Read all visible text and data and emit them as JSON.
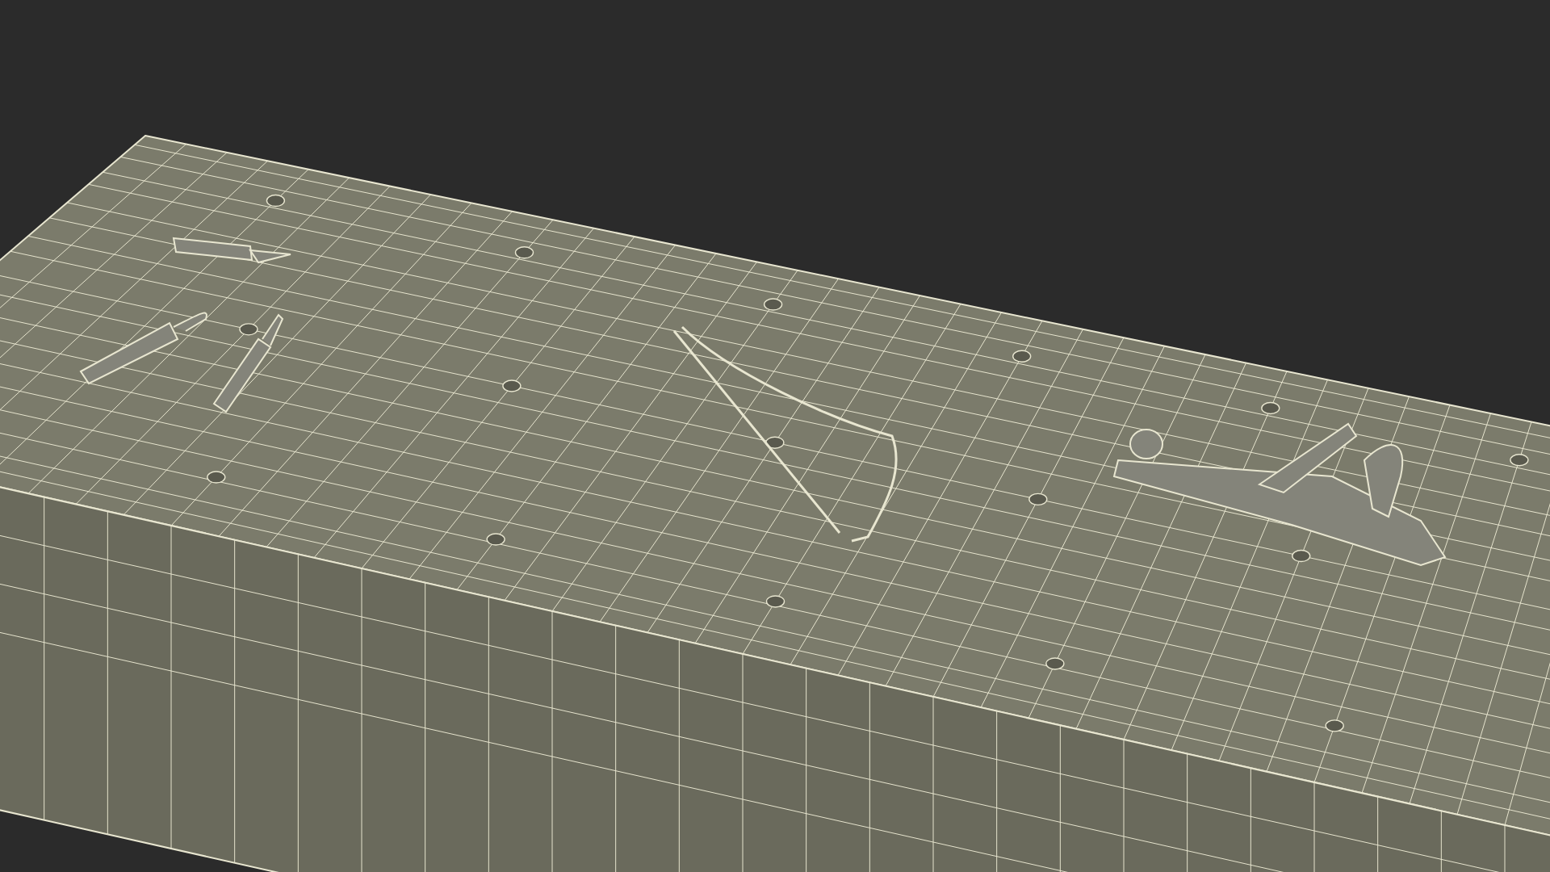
{
  "scene": {
    "kind": "wireframe"
  }
}
